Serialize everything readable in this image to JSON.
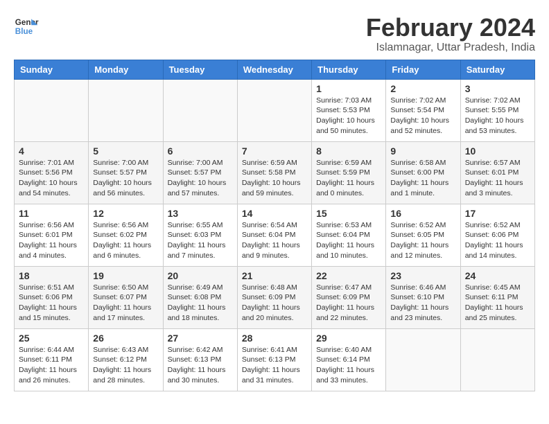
{
  "logo": {
    "line1": "General",
    "line2": "Blue"
  },
  "title": "February 2024",
  "location": "Islamnagar, Uttar Pradesh, India",
  "weekdays": [
    "Sunday",
    "Monday",
    "Tuesday",
    "Wednesday",
    "Thursday",
    "Friday",
    "Saturday"
  ],
  "weeks": [
    [
      {
        "day": "",
        "info": ""
      },
      {
        "day": "",
        "info": ""
      },
      {
        "day": "",
        "info": ""
      },
      {
        "day": "",
        "info": ""
      },
      {
        "day": "1",
        "info": "Sunrise: 7:03 AM\nSunset: 5:53 PM\nDaylight: 10 hours\nand 50 minutes."
      },
      {
        "day": "2",
        "info": "Sunrise: 7:02 AM\nSunset: 5:54 PM\nDaylight: 10 hours\nand 52 minutes."
      },
      {
        "day": "3",
        "info": "Sunrise: 7:02 AM\nSunset: 5:55 PM\nDaylight: 10 hours\nand 53 minutes."
      }
    ],
    [
      {
        "day": "4",
        "info": "Sunrise: 7:01 AM\nSunset: 5:56 PM\nDaylight: 10 hours\nand 54 minutes."
      },
      {
        "day": "5",
        "info": "Sunrise: 7:00 AM\nSunset: 5:57 PM\nDaylight: 10 hours\nand 56 minutes."
      },
      {
        "day": "6",
        "info": "Sunrise: 7:00 AM\nSunset: 5:57 PM\nDaylight: 10 hours\nand 57 minutes."
      },
      {
        "day": "7",
        "info": "Sunrise: 6:59 AM\nSunset: 5:58 PM\nDaylight: 10 hours\nand 59 minutes."
      },
      {
        "day": "8",
        "info": "Sunrise: 6:59 AM\nSunset: 5:59 PM\nDaylight: 11 hours\nand 0 minutes."
      },
      {
        "day": "9",
        "info": "Sunrise: 6:58 AM\nSunset: 6:00 PM\nDaylight: 11 hours\nand 1 minute."
      },
      {
        "day": "10",
        "info": "Sunrise: 6:57 AM\nSunset: 6:01 PM\nDaylight: 11 hours\nand 3 minutes."
      }
    ],
    [
      {
        "day": "11",
        "info": "Sunrise: 6:56 AM\nSunset: 6:01 PM\nDaylight: 11 hours\nand 4 minutes."
      },
      {
        "day": "12",
        "info": "Sunrise: 6:56 AM\nSunset: 6:02 PM\nDaylight: 11 hours\nand 6 minutes."
      },
      {
        "day": "13",
        "info": "Sunrise: 6:55 AM\nSunset: 6:03 PM\nDaylight: 11 hours\nand 7 minutes."
      },
      {
        "day": "14",
        "info": "Sunrise: 6:54 AM\nSunset: 6:04 PM\nDaylight: 11 hours\nand 9 minutes."
      },
      {
        "day": "15",
        "info": "Sunrise: 6:53 AM\nSunset: 6:04 PM\nDaylight: 11 hours\nand 10 minutes."
      },
      {
        "day": "16",
        "info": "Sunrise: 6:52 AM\nSunset: 6:05 PM\nDaylight: 11 hours\nand 12 minutes."
      },
      {
        "day": "17",
        "info": "Sunrise: 6:52 AM\nSunset: 6:06 PM\nDaylight: 11 hours\nand 14 minutes."
      }
    ],
    [
      {
        "day": "18",
        "info": "Sunrise: 6:51 AM\nSunset: 6:06 PM\nDaylight: 11 hours\nand 15 minutes."
      },
      {
        "day": "19",
        "info": "Sunrise: 6:50 AM\nSunset: 6:07 PM\nDaylight: 11 hours\nand 17 minutes."
      },
      {
        "day": "20",
        "info": "Sunrise: 6:49 AM\nSunset: 6:08 PM\nDaylight: 11 hours\nand 18 minutes."
      },
      {
        "day": "21",
        "info": "Sunrise: 6:48 AM\nSunset: 6:09 PM\nDaylight: 11 hours\nand 20 minutes."
      },
      {
        "day": "22",
        "info": "Sunrise: 6:47 AM\nSunset: 6:09 PM\nDaylight: 11 hours\nand 22 minutes."
      },
      {
        "day": "23",
        "info": "Sunrise: 6:46 AM\nSunset: 6:10 PM\nDaylight: 11 hours\nand 23 minutes."
      },
      {
        "day": "24",
        "info": "Sunrise: 6:45 AM\nSunset: 6:11 PM\nDaylight: 11 hours\nand 25 minutes."
      }
    ],
    [
      {
        "day": "25",
        "info": "Sunrise: 6:44 AM\nSunset: 6:11 PM\nDaylight: 11 hours\nand 26 minutes."
      },
      {
        "day": "26",
        "info": "Sunrise: 6:43 AM\nSunset: 6:12 PM\nDaylight: 11 hours\nand 28 minutes."
      },
      {
        "day": "27",
        "info": "Sunrise: 6:42 AM\nSunset: 6:13 PM\nDaylight: 11 hours\nand 30 minutes."
      },
      {
        "day": "28",
        "info": "Sunrise: 6:41 AM\nSunset: 6:13 PM\nDaylight: 11 hours\nand 31 minutes."
      },
      {
        "day": "29",
        "info": "Sunrise: 6:40 AM\nSunset: 6:14 PM\nDaylight: 11 hours\nand 33 minutes."
      },
      {
        "day": "",
        "info": ""
      },
      {
        "day": "",
        "info": ""
      }
    ]
  ]
}
